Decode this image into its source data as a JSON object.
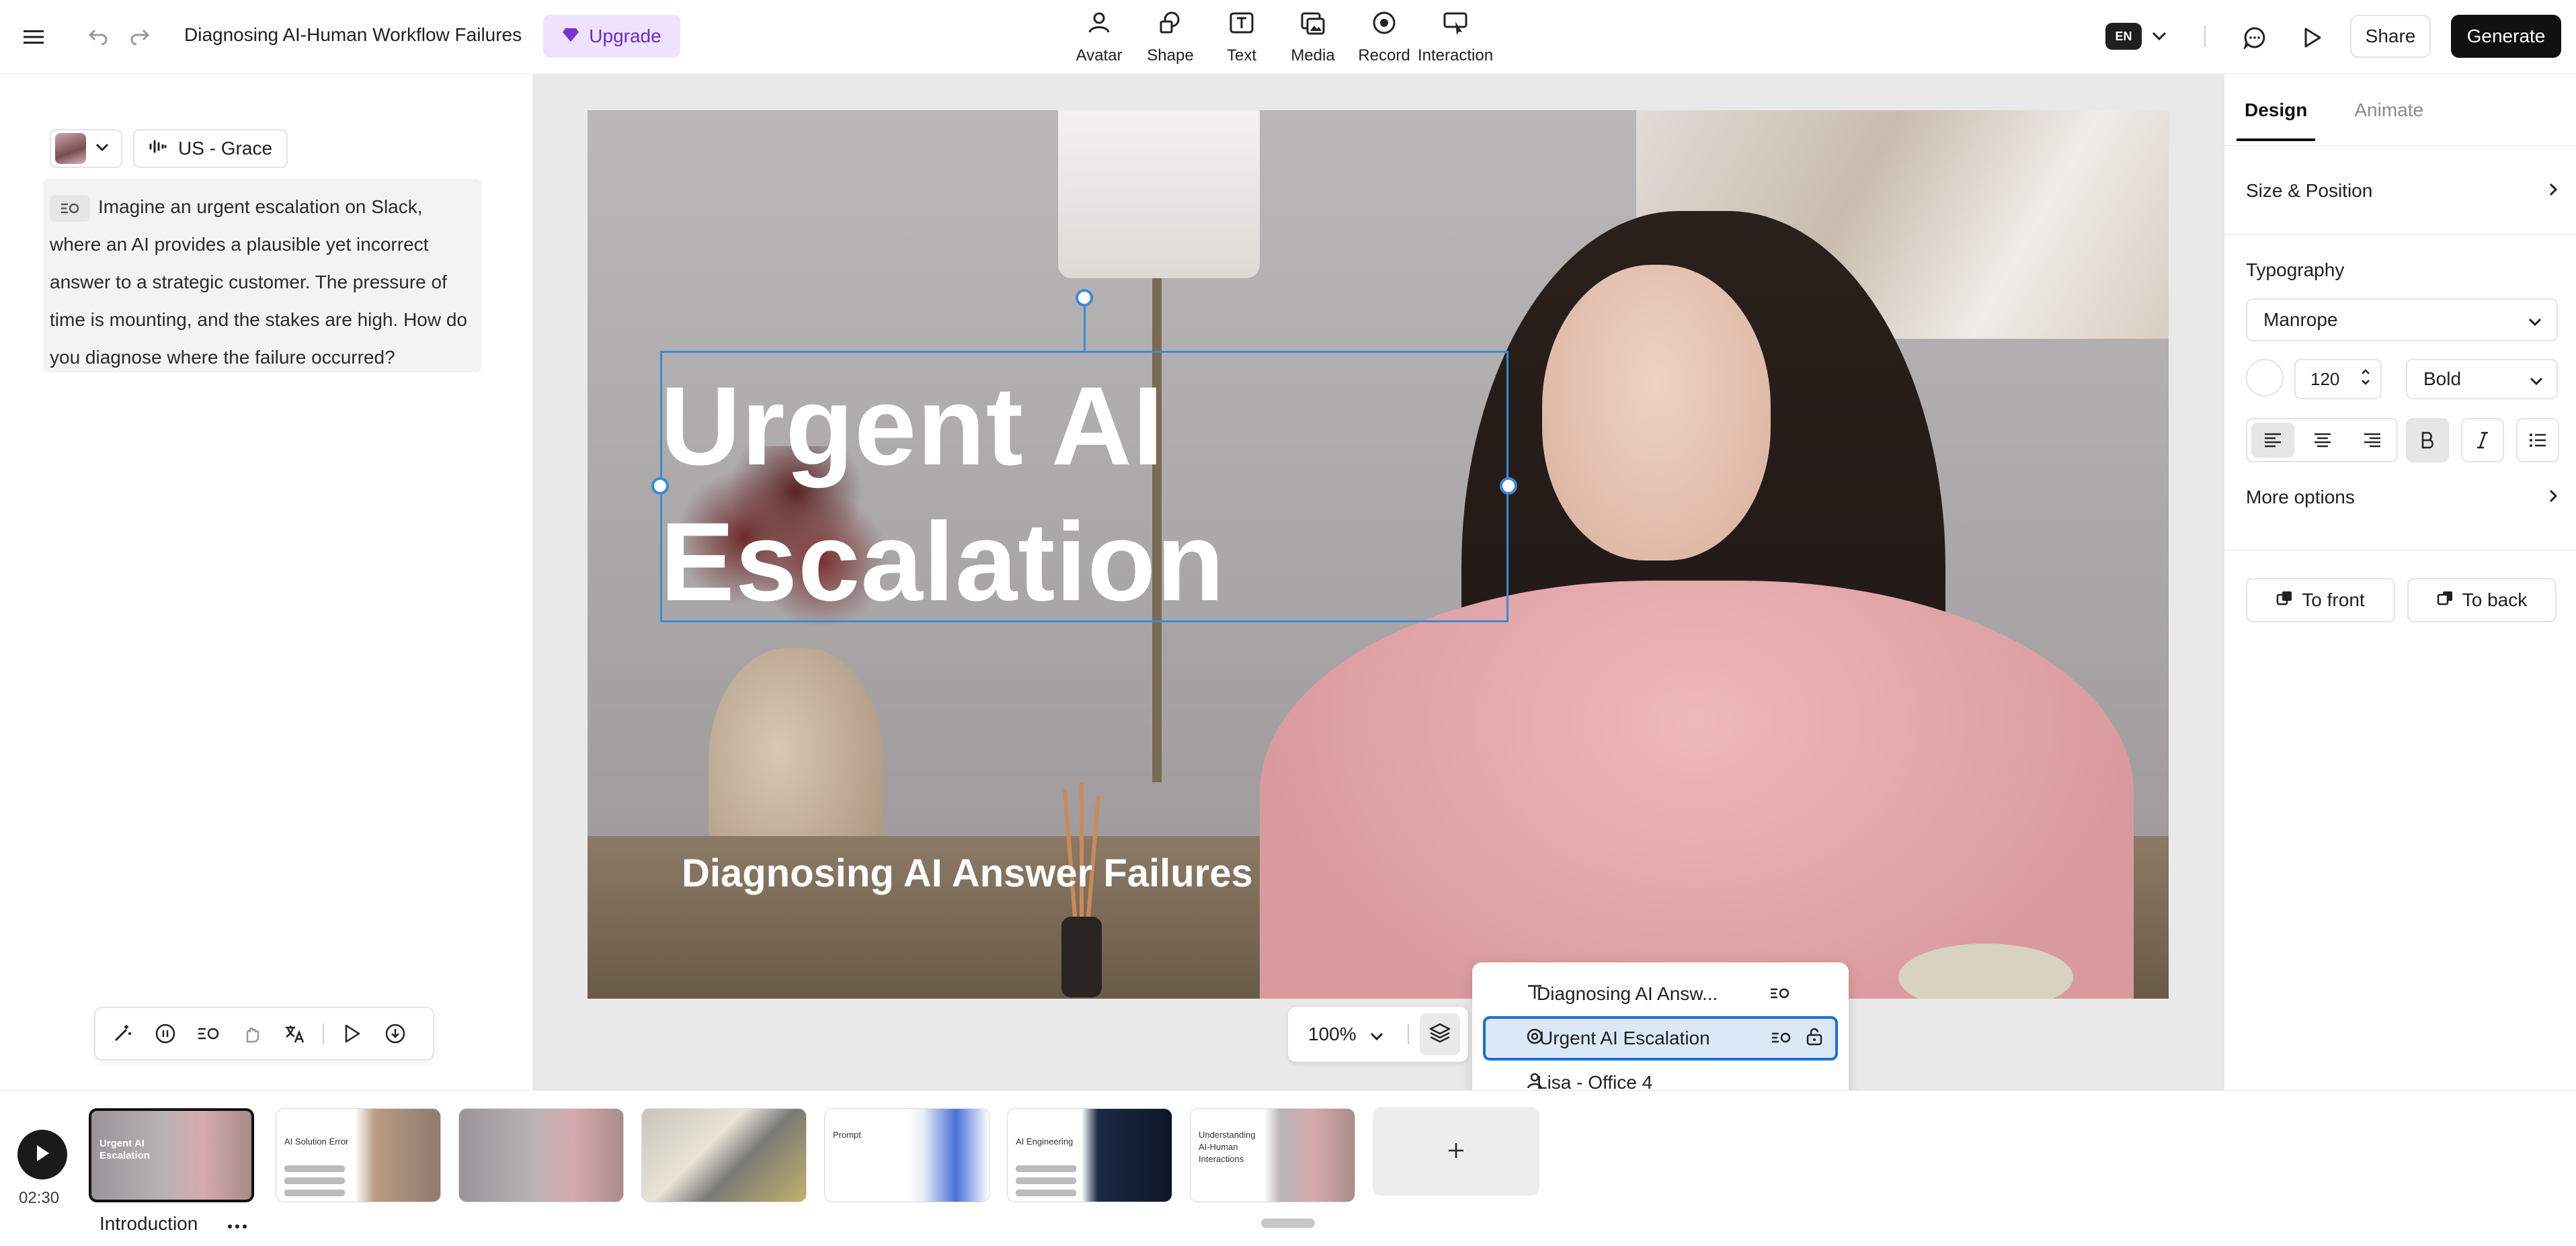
{
  "header": {
    "title": "Diagnosing AI-Human Workflow Failures",
    "upgrade_label": "Upgrade",
    "tools": [
      {
        "label": "Avatar",
        "icon": "avatar-icon"
      },
      {
        "label": "Shape",
        "icon": "shape-icon"
      },
      {
        "label": "Text",
        "icon": "text-icon"
      },
      {
        "label": "Media",
        "icon": "media-icon"
      },
      {
        "label": "Record",
        "icon": "record-icon"
      },
      {
        "label": "Interaction",
        "icon": "interaction-icon"
      }
    ],
    "language": "EN",
    "share_label": "Share",
    "generate_label": "Generate"
  },
  "left_panel": {
    "voice_label": "US - Grace",
    "script_text": "Imagine an urgent escalation on Slack, where an AI provides a plausible yet incorrect answer to a strategic customer. The pressure of time is mounting, and the stakes are high. How do you diagnose where the failure occurred?"
  },
  "canvas": {
    "title_line1": "Urgent AI",
    "title_line2": "Escalation",
    "subtitle": "Diagnosing AI Answer Failures",
    "zoom": "100%"
  },
  "layers": [
    {
      "label": "Diagnosing AI Answ...",
      "type": "text"
    },
    {
      "label": "Urgent AI Escalation",
      "type": "text",
      "selected": true
    },
    {
      "label": "Lisa - Office 4",
      "type": "avatar"
    }
  ],
  "design_panel": {
    "tab_design": "Design",
    "tab_animate": "Animate",
    "size_position": "Size & Position",
    "typography": "Typography",
    "font": "Manrope",
    "font_size": "120",
    "font_weight": "Bold",
    "more_options": "More options",
    "to_front": "To front",
    "to_back": "To back"
  },
  "timeline": {
    "duration": "02:30",
    "scene_label": "Introduction",
    "thumbs": [
      {
        "title": "Urgent AI Escalation",
        "selected": true
      },
      {
        "title": "AI Solution Error"
      },
      {
        "title": ""
      },
      {
        "title": ""
      },
      {
        "title": "Prompt"
      },
      {
        "title": "AI Engineering"
      },
      {
        "title": "Understanding AI-Human Interactions"
      }
    ]
  },
  "colors": {
    "accent": "#3b8ad6",
    "upgrade_bg": "#efe2ff",
    "upgrade_text": "#6b2bbf",
    "primary_button": "#111111"
  }
}
